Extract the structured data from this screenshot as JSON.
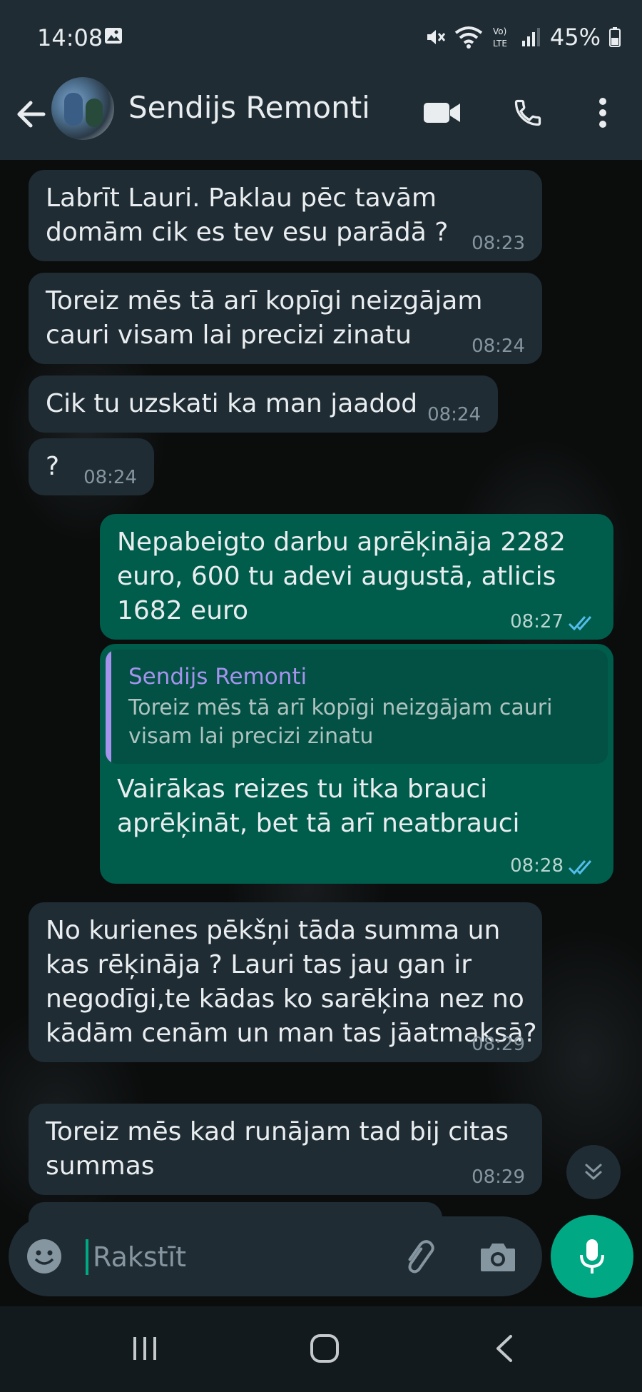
{
  "status_bar": {
    "time": "14:08",
    "battery": "45%"
  },
  "header": {
    "contact_name": "Sendijs Remonti"
  },
  "messages": [
    {
      "dir": "in",
      "lines": [
        "Labrīt Lauri. Paklau pēc tavām",
        "domām cik es tev esu parādā  ?"
      ],
      "time": "08:23"
    },
    {
      "dir": "in",
      "lines": [
        "Toreiz mēs tā arī kopīgi neizgājam",
        "cauri visam lai precizi zinatu"
      ],
      "time": "08:24"
    },
    {
      "dir": "in",
      "lines": [
        "Cik tu uzskati ka man jaadod"
      ],
      "time": "08:24"
    },
    {
      "dir": "in",
      "lines": [
        "?"
      ],
      "time": "08:24"
    },
    {
      "dir": "out",
      "lines": [
        "Nepabeigto darbu aprēķināja 2282",
        "euro, 600 tu adevi augustā, atlicis",
        "1682 euro"
      ],
      "time": "08:27",
      "status": "read"
    },
    {
      "dir": "out",
      "quote": {
        "name": "Sendijs Remonti",
        "lines": [
          "Toreiz mēs tā arī kopīgi neizgājam cauri",
          "visam lai precizi zinatu"
        ]
      },
      "lines": [
        "Vairākas reizes tu itka brauci",
        "aprēķināt, bet tā arī neatbrauci"
      ],
      "time": "08:28",
      "status": "read"
    },
    {
      "dir": "in",
      "lines": [
        "No kurienes pēkšņi tāda summa un",
        "kas rēķināja ? Lauri tas jau gan ir",
        "negodīgi,te kādas ko sarēķina nez no",
        "kādām cenām un man tas jāatmaksā?"
      ],
      "time": "08:29"
    },
    {
      "dir": "in",
      "lines": [
        "Toreiz mēs kad runājam tad bij citas",
        "summas"
      ],
      "time": "08:29"
    }
  ],
  "composer": {
    "placeholder": "Rakstīt"
  },
  "colors": {
    "incoming": "#1f2c34",
    "outgoing": "#005c4b",
    "accent": "#00a884",
    "read_ticks": "#53bdeb",
    "quote_name": "#a593ed"
  },
  "icons": [
    "back-arrow-icon",
    "video-call-icon",
    "phone-icon",
    "more-vert-icon",
    "emoji-icon",
    "attach-icon",
    "camera-icon",
    "mic-icon",
    "chevron-double-down-icon",
    "recents-icon",
    "home-icon",
    "back-icon"
  ]
}
